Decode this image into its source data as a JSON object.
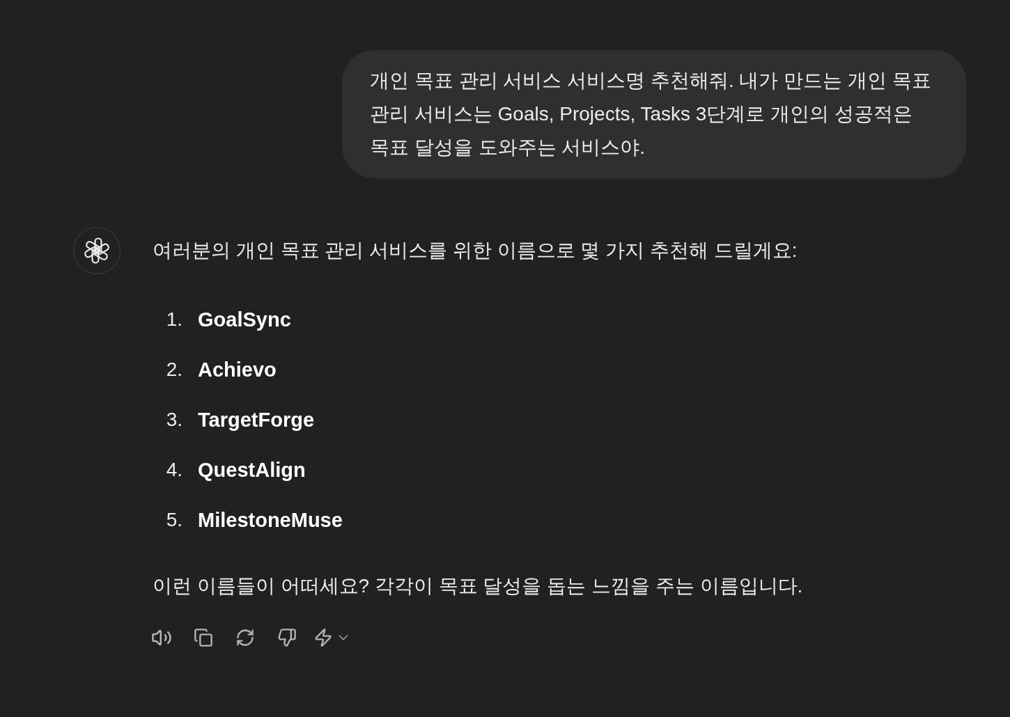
{
  "user_message": {
    "text": "개인 목표 관리 서비스 서비스명 추천해줘. 내가 만드는 개인 목표 관리 서비스는 Goals, Projects, Tasks 3단계로 개인의 성공적은 목표 달성을 도와주는 서비스야."
  },
  "assistant_message": {
    "intro": "여러분의 개인 목표 관리 서비스를 위한 이름으로 몇 가지 추천해 드릴게요:",
    "suggestions": [
      {
        "number": "1.",
        "name": "GoalSync"
      },
      {
        "number": "2.",
        "name": "Achievo"
      },
      {
        "number": "3.",
        "name": "TargetForge"
      },
      {
        "number": "4.",
        "name": "QuestAlign"
      },
      {
        "number": "5.",
        "name": "MilestoneMuse"
      }
    ],
    "closing": "이런 이름들이 어떠세요? 각각이 목표 달성을 돕는 느낌을 주는 이름입니다."
  }
}
